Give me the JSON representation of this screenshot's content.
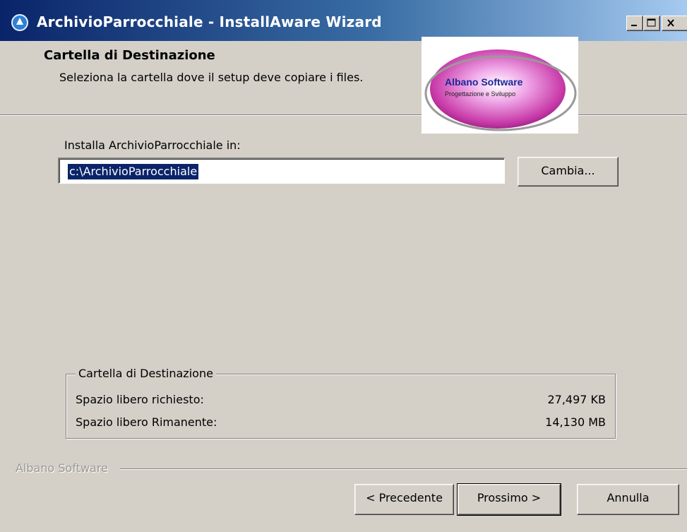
{
  "window": {
    "title": "ArchivioParrocchiale - InstallAware Wizard"
  },
  "header": {
    "title": "Cartella di Destinazione",
    "subtitle": "Seleziona la cartella dove il setup deve copiare i files.",
    "logo": {
      "brand": "Albano Software",
      "tagline": "Progettazione e Sviluppo"
    }
  },
  "install": {
    "label": "Installa ArchivioParrocchiale in:",
    "path_value": "c:\\ArchivioParrocchiale",
    "change_button": "Cambia..."
  },
  "destination_group": {
    "title": "Cartella di Destinazione",
    "rows": [
      {
        "label": "Spazio libero richiesto:",
        "value": "27,497 KB"
      },
      {
        "label": "Spazio libero Rimanente:",
        "value": "14,130 MB"
      }
    ]
  },
  "footer": {
    "brand": "Albano Software",
    "back_button": "< Precedente",
    "next_button": "Prossimo >",
    "cancel_button": "Annulla"
  },
  "colors": {
    "titlebar_start": "#0a246a",
    "titlebar_end": "#a6caf0",
    "face": "#d4d0c8",
    "selection": "#0a246a"
  }
}
